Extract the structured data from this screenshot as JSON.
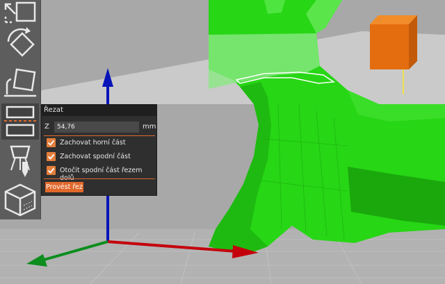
{
  "icons": {
    "tool_1": "select-scale-icon",
    "tool_2": "rotate-icon",
    "tool_3": "place-on-face-icon",
    "tool_4": "cut-icon",
    "tool_5": "paint-supports-icon",
    "tool_6": "seam-cube-icon",
    "view_cube": "orientation-cube-icon"
  },
  "colors": {
    "model": "#22d313",
    "accent": "#e0682b",
    "axis_x": "#c4000c",
    "axis_y": "#0c8d1e",
    "axis_z": "#0714b8",
    "panel_bg": "#2f2f2f"
  },
  "cut_panel": {
    "title": "Řezat",
    "z_label": "Z",
    "z_value": "54,76",
    "unit": "mm",
    "options": [
      {
        "label": "Zachovat horní část",
        "checked": true
      },
      {
        "label": "Zachovat spodní část",
        "checked": true
      },
      {
        "label": "Otočit spodní část řezem dolů",
        "checked": true
      }
    ],
    "button_label": "Provést řez"
  }
}
